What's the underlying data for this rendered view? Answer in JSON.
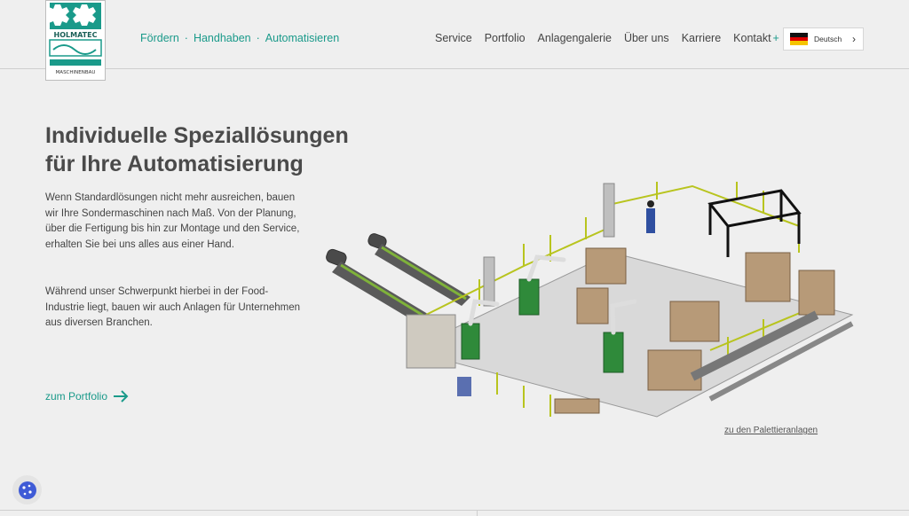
{
  "logo": {
    "brand": "HOLMATEC",
    "sub": "MASCHINENBAU"
  },
  "tagline": [
    "Fördern",
    "Handhaben",
    "Automatisieren"
  ],
  "tagline_separator": "·",
  "nav": [
    {
      "label": "Service"
    },
    {
      "label": "Portfolio"
    },
    {
      "label": "Anlagengalerie"
    },
    {
      "label": "Über uns"
    },
    {
      "label": "Karriere"
    },
    {
      "label": "Kontakt"
    }
  ],
  "nav_plus": "+",
  "language": {
    "label": "Deutsch",
    "icon": "chevron-right-icon"
  },
  "hero": {
    "title_line1": "Individuelle Speziallösungen",
    "title_line2": "für Ihre Automatisierung",
    "paragraph1": "Wenn Standardlösungen nicht mehr ausreichen, bauen wir Ihre Sondermaschinen nach Maß. Von der Planung, über die Fertigung bis hin zur Montage und den Service, erhalten Sie bei uns alles aus einer Hand.",
    "paragraph2": "Während unser Schwerpunkt hierbei in der Food-Industrie liegt, bauen wir auch Anlagen für Unternehmen aus diversen Branchen.",
    "cta": "zum Portfolio",
    "image_link": "zu den Palettieranlagen"
  },
  "colors": {
    "accent": "#1a9a8a",
    "background": "#efefef",
    "text": "#444444"
  }
}
